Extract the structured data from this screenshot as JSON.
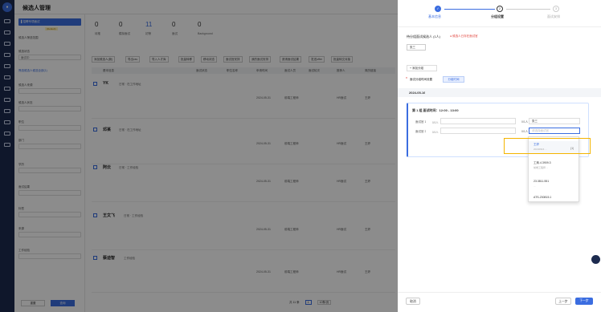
{
  "header": {
    "title": "候选人管理"
  },
  "filter": {
    "project": "▌招聘专项面试",
    "tag": "(Default)",
    "section": "候选人筛选范围",
    "label_status": "候选状态",
    "status_value": "面试中",
    "more": "筛选候选人候选全部(1)",
    "fields": [
      "候选人来源",
      "候选人状态",
      "职位",
      "部门",
      "学历",
      "面试结果",
      "标签",
      "来源",
      "工作经验"
    ],
    "reset": "重置",
    "search": "查询"
  },
  "stats": [
    {
      "n": "0",
      "l": "待推"
    },
    {
      "n": "0",
      "l": "模拟面试"
    },
    {
      "n": "11",
      "l": "初筛"
    },
    {
      "n": "0",
      "l": "面试"
    },
    {
      "n": "0",
      "l": "Background"
    }
  ],
  "toolbar": [
    "添加候选人(新)",
    "导出csv",
    "导入人才库",
    "批量转移",
    "移动状态",
    "面试官安排",
    "我的面试安排",
    "邀请面试结果",
    "发送offer",
    "批量转交对接"
  ],
  "table": {
    "cols": [
      "基本信息",
      "面试状态",
      "职位名称",
      "申请时间",
      "面试人员",
      "面试轮次",
      "推荐人",
      "简历链接"
    ],
    "rows": [
      {
        "name": "YK",
        "tag": "日常 · 在工作地址",
        "date": "2024-05-31",
        "pos": "前端工程师",
        "stage": "HR面试",
        "owner": "王婷"
      },
      {
        "name": "邓某",
        "tag": "日常 · 在工作地址",
        "date": "2024-05-31",
        "pos": "前端工程师",
        "stage": "HR面试",
        "owner": "王婷"
      },
      {
        "name": "阿云",
        "tag": "日常 · 工作经验",
        "date": "2024-05-31",
        "pos": "前端工程师",
        "stage": "HR面试",
        "owner": "王婷"
      },
      {
        "name": "王文飞",
        "tag": "日常 · 工作经验",
        "date": "2024-05-31",
        "pos": "前端工程师",
        "stage": "HR面试",
        "owner": "王婷"
      },
      {
        "name": "蔡迪智",
        "tag": "工作经验",
        "date": "2024-05-31",
        "pos": "前端工程师",
        "stage": "HR面试",
        "owner": "王婷"
      }
    ]
  },
  "pager": {
    "text": "共 11 条",
    "page": "1",
    "size": "10条/页"
  },
  "drawer": {
    "steps": [
      "基本信息",
      "分组设置",
      "面试安排"
    ],
    "title": "待分组面试候选人 (1人)",
    "warn": "● 候选人已存在面试官",
    "cand": "张三",
    "add_group": "+ 添加分组",
    "time_label": "面试分组时间设置",
    "time_btn": "分组时间",
    "date": "2024-05-16",
    "slot": "第 1 组 面试时间：12:00 - 13:00",
    "r1": {
      "label": "面试官 1",
      "cnt": "0/1人",
      "sel": "张三"
    },
    "r2": {
      "label": "面试官 2",
      "cnt": "0/1人",
      "sel": "请选择",
      "ph": "请选择面试官"
    },
    "dd": [
      {
        "a": "王婷",
        "b": "20240916 ..."
      },
      {
        "a": "工商.4.3909.3",
        "b": "前端工程师 ..."
      },
      {
        "a": "23.3811.551",
        "b": "..."
      },
      {
        "a": "ATS-230815.1",
        "b": "..."
      }
    ],
    "dd_count": "(1)",
    "cancel": "取消",
    "prev": "上一步",
    "next": "下一步"
  }
}
